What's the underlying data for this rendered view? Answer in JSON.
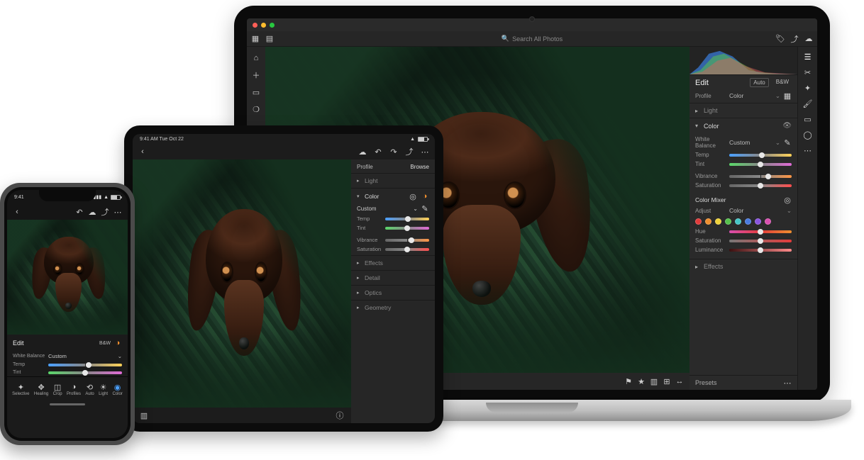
{
  "laptop": {
    "search_placeholder": "Search All Photos",
    "top_icons_left": [
      "photos-icon",
      "grid-icon"
    ],
    "top_icons_right": [
      "tag-icon",
      "share-icon",
      "cloud-icon"
    ],
    "left_rail_icons": [
      "home-icon",
      "folder-icon",
      "plus-icon",
      "learn-icon"
    ],
    "right_tool_icons": [
      "sliders-icon",
      "crop-icon",
      "healing-icon",
      "brush-icon",
      "linear-grad-icon",
      "radial-grad-icon",
      "more-icon"
    ],
    "edit": {
      "title": "Edit",
      "auto": "Auto",
      "bw": "B&W",
      "profile_label": "Profile",
      "profile_value": "Color"
    },
    "sections": {
      "light": "Light",
      "color": "Color",
      "effects": "Effects"
    },
    "wb": {
      "label": "White Balance",
      "value": "Custom"
    },
    "sliders": {
      "temp": {
        "label": "Temp",
        "pos": 52
      },
      "tint": {
        "label": "Tint",
        "pos": 50
      },
      "vibrance": {
        "label": "Vibrance",
        "pos": 62
      },
      "saturation": {
        "label": "Saturation",
        "pos": 50
      }
    },
    "mixer": {
      "title": "Color Mixer",
      "adjust_label": "Adjust",
      "adjust_value": "Color",
      "colors": [
        "#e33b3b",
        "#ef8f2f",
        "#efd23a",
        "#57c24d",
        "#46c6c6",
        "#4a7be0",
        "#8a55e0",
        "#d84fb0"
      ],
      "hue": {
        "label": "Hue",
        "pos": 50
      },
      "saturation": {
        "label": "Saturation",
        "pos": 50
      },
      "luminance": {
        "label": "Luminance",
        "pos": 50
      }
    },
    "presets": "Presets",
    "filmstrip_flag": "Flag"
  },
  "tablet": {
    "status_time": "9:41 AM  Tue Oct 22",
    "profile_label": "Profile",
    "profile_value": "Browse",
    "sections": {
      "light": "Light",
      "color": "Color",
      "effects": "Effects",
      "detail": "Detail",
      "optics": "Optics",
      "geometry": "Geometry"
    },
    "wb_value": "Custom",
    "sliders": {
      "temp": {
        "label": "Temp",
        "pos": 52
      },
      "tint": {
        "label": "Tint",
        "pos": 50
      },
      "vibrance": {
        "label": "Vibrance",
        "pos": 60
      },
      "saturation": {
        "label": "Saturation",
        "pos": 50
      }
    }
  },
  "phone": {
    "status_time": "9:41",
    "edit": {
      "title": "Edit",
      "bw": "B&W"
    },
    "wb": {
      "label": "White Balance",
      "value": "Custom"
    },
    "sliders": {
      "temp": {
        "label": "Temp",
        "pos": 55
      },
      "tint": {
        "label": "Tint",
        "pos": 50
      }
    },
    "tools": [
      {
        "icon": "✦",
        "label": "Selective",
        "name": "selective-tool"
      },
      {
        "icon": "✥",
        "label": "Healing",
        "name": "healing-tool"
      },
      {
        "icon": "◫",
        "label": "Crop",
        "name": "crop-tool"
      },
      {
        "icon": "◑",
        "label": "Profiles",
        "name": "profiles-tool"
      },
      {
        "icon": "⟲",
        "label": "Auto",
        "name": "auto-tool"
      },
      {
        "icon": "☀",
        "label": "Light",
        "name": "light-tool"
      },
      {
        "icon": "◉",
        "label": "Color",
        "name": "color-tool"
      }
    ]
  }
}
